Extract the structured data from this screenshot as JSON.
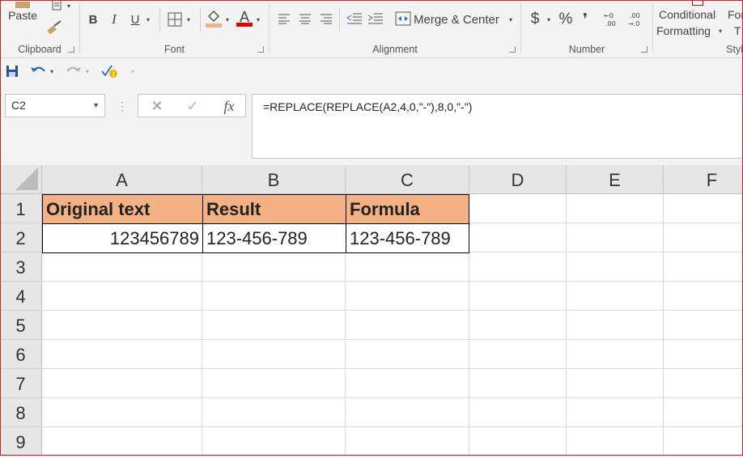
{
  "ribbon": {
    "clipboard": {
      "paste_label": "Paste",
      "group_label": "Clipboard"
    },
    "font": {
      "bold": "B",
      "italic": "I",
      "underline": "U",
      "font_color_letter": "A",
      "group_label": "Font"
    },
    "alignment": {
      "merge_label": "Merge & Center",
      "group_label": "Alignment"
    },
    "number": {
      "currency": "$",
      "percent": "%",
      "group_label": "Number"
    },
    "styles": {
      "conditional_line1": "Conditional",
      "conditional_line2": "Formatting",
      "format_line1": "For",
      "format_line2": "T",
      "group_label": "Styl"
    }
  },
  "formula_bar": {
    "name_box": "C2",
    "fx": "fx",
    "formula": "=REPLACE(REPLACE(A2,4,0,\"-\"),8,0,\"-\")"
  },
  "sheet": {
    "columns": [
      "A",
      "B",
      "C",
      "D",
      "E",
      "F"
    ],
    "rows": [
      "1",
      "2",
      "3",
      "4",
      "5",
      "6",
      "7",
      "8",
      "9"
    ],
    "cells": {
      "A1": "Original text",
      "B1": "Result",
      "C1": "Formula",
      "A2": "123456789",
      "B2": "123-456-789",
      "C2": "123-456-789"
    }
  },
  "colors": {
    "header_fill": "#f4b183",
    "font_color_bar": "#e00000",
    "fill_color_bar": "#f4b183"
  }
}
